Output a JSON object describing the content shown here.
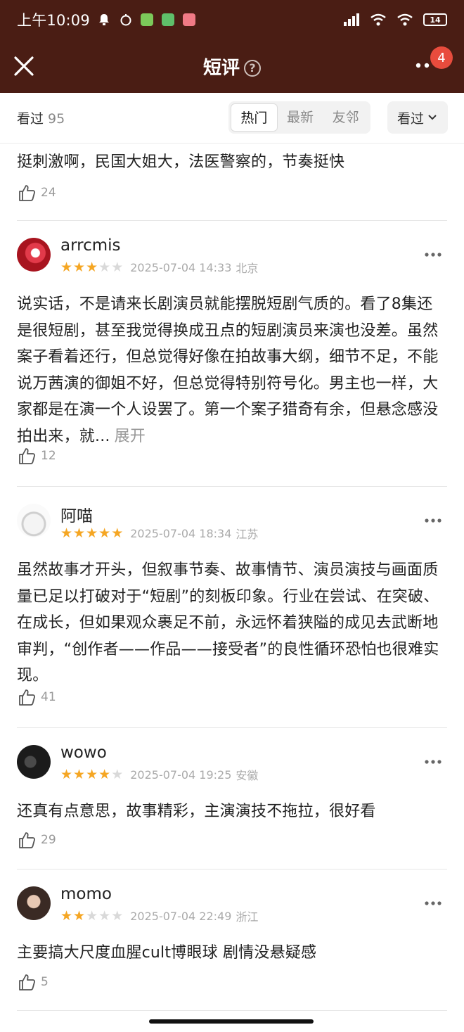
{
  "status_bar": {
    "time": "上午10:09",
    "battery": "14"
  },
  "nav": {
    "title": "短评",
    "help": "?",
    "badge": "4"
  },
  "filter": {
    "seen_label": "看过",
    "seen_count": "95",
    "tabs": [
      {
        "label": "热门",
        "active": true
      },
      {
        "label": "最新",
        "active": false
      },
      {
        "label": "友邻",
        "active": false
      }
    ],
    "dropdown_label": "看过"
  },
  "partial_review": {
    "text": "挺刺激啊，民国大姐大，法医警察的，节奏挺快",
    "likes": "24"
  },
  "reviews": [
    {
      "username": "arrcmis",
      "rating": 3,
      "date": "2025-07-04 14:33",
      "location": "北京",
      "text": "说实话，不是请来长剧演员就能摆脱短剧气质的。看了8集还是很短剧，甚至我觉得换成丑点的短剧演员来演也没差。虽然案子看着还行，但总觉得好像在拍故事大纲，细节不足，不能说万茜演的御姐不好，但总觉得特别符号化。男主也一样，大家都是在演一个人设罢了。第一个案子猎奇有余，但悬念感没拍出来，就...",
      "expand": "展开",
      "likes": "12"
    },
    {
      "username": "阿喵",
      "rating": 5,
      "date": "2025-07-04 18:34",
      "location": "江苏",
      "text": "虽然故事才开头，但叙事节奏、故事情节、演员演技与画面质量已足以打破对于“短剧”的刻板印象。行业在尝试、在突破、在成长，但如果观众裹足不前，永远怀着狭隘的成见去武断地审判，“创作者——作品——接受者”的良性循环恐怕也很难实现。",
      "likes": "41"
    },
    {
      "username": "wowo",
      "rating": 4,
      "date": "2025-07-04 19:25",
      "location": "安徽",
      "text": "还真有点意思，故事精彩，主演演技不拖拉，很好看",
      "likes": "29"
    },
    {
      "username": "momo",
      "rating": 2,
      "date": "2025-07-04 22:49",
      "location": "浙江",
      "text": "主要搞大尺度血腥cult博眼球 剧情没悬疑感",
      "likes": "5"
    }
  ],
  "colors": {
    "header_bg": "#4a1d14",
    "star": "#f5a623",
    "badge": "#e84c3d"
  }
}
